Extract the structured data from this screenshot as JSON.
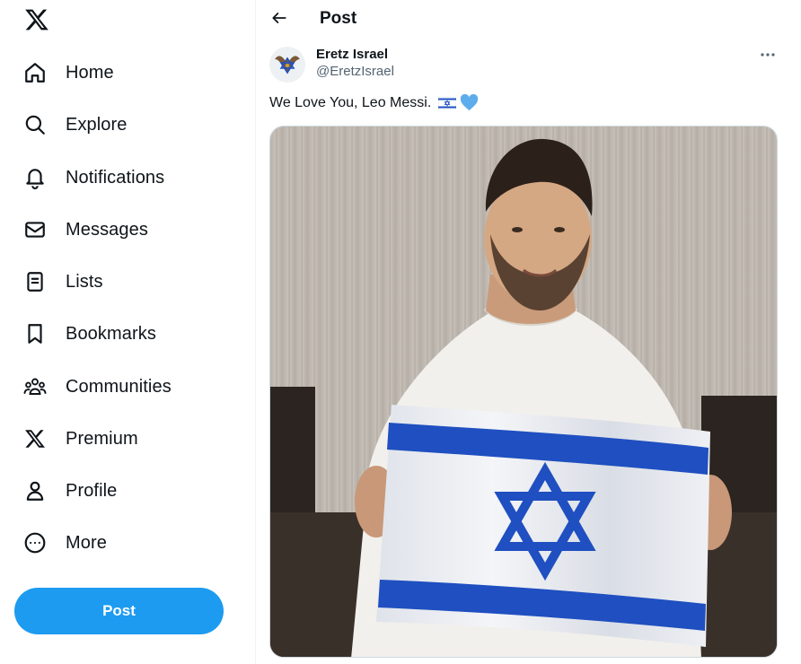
{
  "sidebar": {
    "logo_icon": "x-logo-icon",
    "items": [
      {
        "label": "Home",
        "icon": "home-icon"
      },
      {
        "label": "Explore",
        "icon": "search-icon"
      },
      {
        "label": "Notifications",
        "icon": "bell-icon"
      },
      {
        "label": "Messages",
        "icon": "envelope-icon"
      },
      {
        "label": "Lists",
        "icon": "list-icon"
      },
      {
        "label": "Bookmarks",
        "icon": "bookmark-icon"
      },
      {
        "label": "Communities",
        "icon": "communities-icon"
      },
      {
        "label": "Premium",
        "icon": "x-logo-icon"
      },
      {
        "label": "Profile",
        "icon": "person-icon"
      },
      {
        "label": "More",
        "icon": "more-circle-icon"
      }
    ],
    "post_button_label": "Post"
  },
  "header": {
    "title": "Post",
    "back_icon": "back-arrow-icon"
  },
  "tweet": {
    "author_name": "Eretz Israel",
    "author_handle": "@EretzIsrael",
    "text": "We Love You, Leo Messi.",
    "emojis": [
      "israel-flag-emoji",
      "blue-heart-emoji"
    ],
    "more_icon": "more-horizontal-icon"
  },
  "colors": {
    "accent": "#1d9bf0",
    "text_primary": "#0f1419",
    "text_secondary": "#536471",
    "border": "#eff3f4",
    "flag_blue": "#1f4fc0"
  }
}
